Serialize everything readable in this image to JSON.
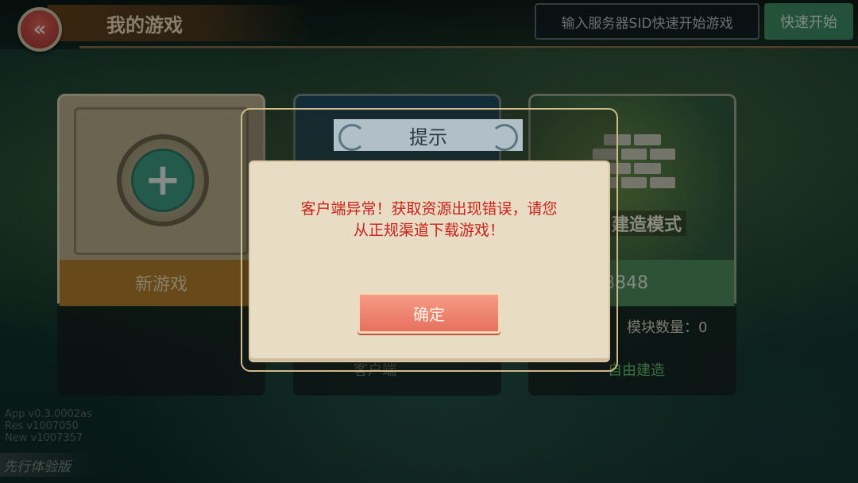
{
  "header": {
    "title": "我的游戏",
    "sid_placeholder": "输入服务器SID快速开始游戏",
    "quick_start_label": "快速开始"
  },
  "cards": {
    "new_game": {
      "label": "新游戏"
    },
    "card2": {
      "sub_label": "客户端"
    },
    "build": {
      "mode_label": "建造模式",
      "number": "8848",
      "block_count": "模块数量：0",
      "free_build": "自由建造"
    }
  },
  "version": {
    "app": "App  v0.3.0002as",
    "res": "Res   v1007050",
    "new": "New  v1007357"
  },
  "trial_tag": "先行体验版",
  "modal": {
    "title": "提示",
    "message_line1": "客户端异常！获取资源出现错误，请您",
    "message_line2": "从正规渠道下载游戏！",
    "ok_label": "确定"
  },
  "colors": {
    "accent_red": "#c9241b",
    "button_red": "#e7715e",
    "green": "#3d8c63"
  }
}
